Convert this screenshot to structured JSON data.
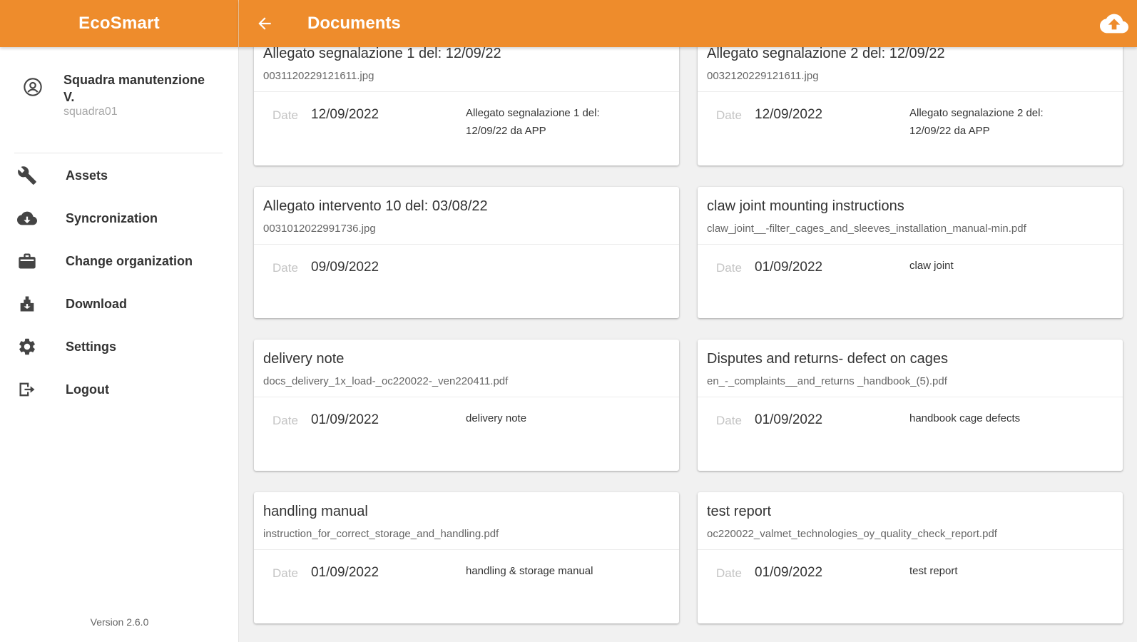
{
  "app": {
    "brand": "EcoSmart",
    "accent_color": "#ee8c2c"
  },
  "header": {
    "title": "Documents",
    "back_icon": "arrow-left-icon",
    "upload_icon": "cloud-upload-icon"
  },
  "sidebar": {
    "user": {
      "name": "Squadra manutenzione V.",
      "id": "squadra01",
      "icon": "account-circle-icon"
    },
    "items": [
      {
        "label": "Assets",
        "icon": "wrench-icon"
      },
      {
        "label": "Syncronization",
        "icon": "cloud-sync-icon"
      },
      {
        "label": "Change organization",
        "icon": "briefcase-icon"
      },
      {
        "label": "Download",
        "icon": "download-icon"
      },
      {
        "label": "Settings",
        "icon": "gear-icon"
      },
      {
        "label": "Logout",
        "icon": "logout-icon"
      }
    ],
    "version": "Version 2.6.0"
  },
  "date_label": "Date",
  "documents": [
    {
      "title": "Allegato segnalazione 1 del: 12/09/22",
      "file": "0031120229121611.jpg",
      "date": "12/09/2022",
      "description": "Allegato segnalazione 1 del: 12/09/22 da APP"
    },
    {
      "title": "Allegato segnalazione 2 del: 12/09/22",
      "file": "0032120229121611.jpg",
      "date": "12/09/2022",
      "description": "Allegato segnalazione 2 del: 12/09/22 da APP"
    },
    {
      "title": "Allegato intervento 10 del: 03/08/22",
      "file": "0031012022991736.jpg",
      "date": "09/09/2022",
      "description": ""
    },
    {
      "title": "claw joint mounting instructions",
      "file": "claw_joint__-filter_cages_and_sleeves_installation_manual-min.pdf",
      "date": "01/09/2022",
      "description": "claw joint"
    },
    {
      "title": "delivery note",
      "file": "docs_delivery_1x_load-_oc220022-_ven220411.pdf",
      "date": "01/09/2022",
      "description": "delivery note"
    },
    {
      "title": "Disputes and returns- defect on cages",
      "file": "en_-_complaints__and_returns _handbook_(5).pdf",
      "date": "01/09/2022",
      "description": "handbook cage defects"
    },
    {
      "title": "handling manual",
      "file": "instruction_for_correct_storage_and_handling.pdf",
      "date": "01/09/2022",
      "description": "handling & storage manual"
    },
    {
      "title": "test report",
      "file": "oc220022_valmet_technologies_oy_quality_check_report.pdf",
      "date": "01/09/2022",
      "description": "test report"
    }
  ]
}
